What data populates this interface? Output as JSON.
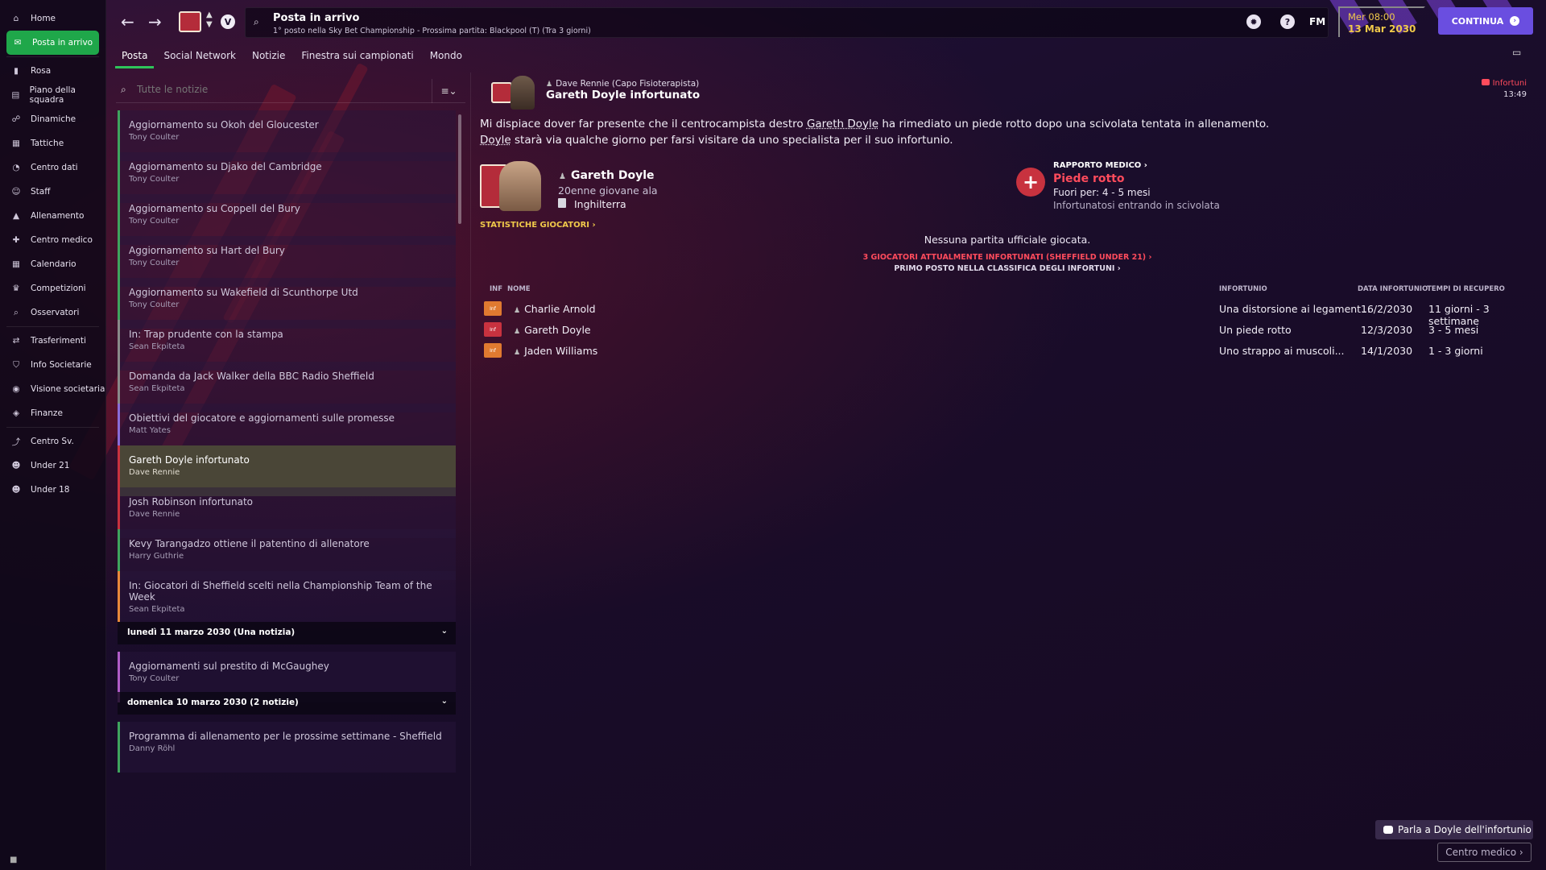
{
  "sidebar": {
    "items": [
      {
        "label": "Home",
        "icon": "home-icon",
        "glyph": "⌂"
      },
      {
        "label": "Posta in arrivo",
        "icon": "inbox-icon",
        "glyph": "✉",
        "active": true
      },
      {
        "label": "Rosa",
        "icon": "squad-icon",
        "glyph": "▮"
      },
      {
        "label": "Piano della squadra",
        "icon": "clipboard-icon",
        "glyph": "▤"
      },
      {
        "label": "Dinamiche",
        "icon": "dynamics-icon",
        "glyph": "☍"
      },
      {
        "label": "Tattiche",
        "icon": "tactics-icon",
        "glyph": "▦"
      },
      {
        "label": "Centro dati",
        "icon": "data-hub-icon",
        "glyph": "◔"
      },
      {
        "label": "Staff",
        "icon": "staff-icon",
        "glyph": "☺"
      },
      {
        "label": "Allenamento",
        "icon": "training-icon",
        "glyph": "▲"
      },
      {
        "label": "Centro medico",
        "icon": "medical-icon",
        "glyph": "✚"
      },
      {
        "label": "Calendario",
        "icon": "calendar-icon",
        "glyph": "▦"
      },
      {
        "label": "Competizioni",
        "icon": "trophy-icon",
        "glyph": "♛"
      },
      {
        "label": "Osservatori",
        "icon": "scouting-icon",
        "glyph": "⌕"
      },
      {
        "label": "Trasferimenti",
        "icon": "transfers-icon",
        "glyph": "⇄"
      },
      {
        "label": "Info Societarie",
        "icon": "club-info-icon",
        "glyph": "⛉"
      },
      {
        "label": "Visione societaria",
        "icon": "club-vision-icon",
        "glyph": "◉"
      },
      {
        "label": "Finanze",
        "icon": "finances-icon",
        "glyph": "◈"
      },
      {
        "label": "Centro Sv.",
        "icon": "development-icon",
        "glyph": "⤴"
      },
      {
        "label": "Under 21",
        "icon": "u21-icon",
        "glyph": "☻"
      },
      {
        "label": "Under 18",
        "icon": "u18-icon",
        "glyph": "☻"
      }
    ]
  },
  "topbar": {
    "title": "Posta in arrivo",
    "subtitle": "1° posto nella Sky Bet Championship - Prossima partita: Blackpool (T) (Tra 3 giorni)",
    "time": "Mer 08:00",
    "date": "13 Mar 2030",
    "continue_label": "CONTINUA",
    "fm_label": "FM"
  },
  "tabs": [
    "Posta",
    "Social Network",
    "Notizie",
    "Finestra sui campionati",
    "Mondo"
  ],
  "inbox": {
    "search_placeholder": "Tutte le notizie",
    "messages": [
      {
        "subject": "Aggiornamento su Okoh del Gloucester",
        "sender": "Tony Coulter",
        "color": "#3fa45e"
      },
      {
        "subject": "Aggiornamento su Djako del Cambridge",
        "sender": "Tony Coulter",
        "color": "#3fa45e"
      },
      {
        "subject": "Aggiornamento su Coppell del Bury",
        "sender": "Tony Coulter",
        "color": "#3fa45e"
      },
      {
        "subject": "Aggiornamento su Hart del Bury",
        "sender": "Tony Coulter",
        "color": "#3fa45e"
      },
      {
        "subject": "Aggiornamento su Wakefield di Scunthorpe Utd",
        "sender": "Tony Coulter",
        "color": "#3fa45e"
      },
      {
        "subject": "In: Trap prudente con la stampa",
        "sender": "Sean Ekpiteta",
        "color": "#8a8a8a"
      },
      {
        "subject": "Domanda da Jack Walker della BBC Radio Sheffield",
        "sender": "Sean Ekpiteta",
        "color": "#8a8a8a"
      },
      {
        "subject": "Obiettivi del giocatore e aggiornamenti sulle promesse",
        "sender": "Matt Yates",
        "color": "#8a6cd8"
      },
      {
        "subject": "Gareth Doyle infortunato",
        "sender": "Dave Rennie",
        "color": "#c8323f",
        "selected": true
      },
      {
        "subject": "Josh Robinson infortunato",
        "sender": "Dave Rennie",
        "color": "#c8323f"
      },
      {
        "subject": "Kevy Tarangadzo ottiene il patentino di allenatore",
        "sender": "Harry Guthrie",
        "color": "#3fa45e"
      },
      {
        "subject": "In: Giocatori di Sheffield scelti nella Championship Team of the Week",
        "sender": "Sean Ekpiteta",
        "color": "#e8883a"
      }
    ],
    "group1": {
      "label": "lunedì 11 marzo 2030 (Una notizia)",
      "messages": [
        {
          "subject": "Aggiornamenti sul prestito di McGaughey",
          "sender": "Tony Coulter",
          "color": "#b05cc8"
        }
      ]
    },
    "group2": {
      "label": "domenica 10 marzo 2030 (2 notizie)",
      "messages": [
        {
          "subject": "Programma di allenamento per le prossime settimane - Sheffield",
          "sender": "Danny Röhl",
          "color": "#3fa45e"
        }
      ]
    }
  },
  "message": {
    "from": "Dave Rennie  (Capo Fisioterapista)",
    "title": "Gareth Doyle infortunato",
    "tag": "Infortuni",
    "time": "13:49",
    "body_1a": "Mi dispiace dover far presente che il centrocampista destro ",
    "body_1b": "Gareth Doyle",
    "body_1c": " ha rimediato un piede rotto dopo una scivolata tentata in allenamento.",
    "body_2a": "Doyle",
    "body_2b": " starà via qualche giorno per farsi visitare da uno specialista per il suo infortunio.",
    "player_name": "Gareth Doyle",
    "player_desc": "20enne giovane ala",
    "player_nation": "Inghilterra",
    "stats_link": "STATISTICHE GIOCATORI ›",
    "med_report_link": "RAPPORTO MEDICO ›",
    "injury": "Piede rotto",
    "out_for": "Fuori per: 4 - 5 mesi",
    "how": "Infortunatosi entrando in scivolata",
    "no_matches": "Nessuna partita ufficiale giocata.",
    "injured_link": "3 GIOCATORI ATTUALMENTE INFORTUNATI (SHEFFIELD UNDER 21) ›",
    "rank_link": "PRIMO POSTO NELLA CLASSIFICA DEGLI INFORTUNI ›"
  },
  "injury_table": {
    "headers": {
      "inf": "INF",
      "name": "NOME",
      "injury": "INFORTUNIO",
      "date": "DATA INFORTUNIO",
      "recovery": "TEMPI DI RECUPERO"
    },
    "rows": [
      {
        "inf": "Inf",
        "inf_color": "#e07a30",
        "name": "Charlie Arnold",
        "injury": "Una distorsione ai legament...",
        "date": "16/2/2030",
        "recovery": "11 giorni - 3 settimane"
      },
      {
        "inf": "Inf",
        "inf_color": "#c8323f",
        "name": "Gareth Doyle",
        "injury": "Un piede rotto",
        "date": "12/3/2030",
        "recovery": "3 - 5 mesi"
      },
      {
        "inf": "Inf",
        "inf_color": "#e07a30",
        "name": "Jaden Williams",
        "injury": "Uno strappo ai muscoli...",
        "date": "14/1/2030",
        "recovery": "1 - 3 giorni"
      }
    ]
  },
  "buttons": {
    "talk": "Parla a Doyle dell'infortunio",
    "medical_center": "Centro medico ›"
  }
}
